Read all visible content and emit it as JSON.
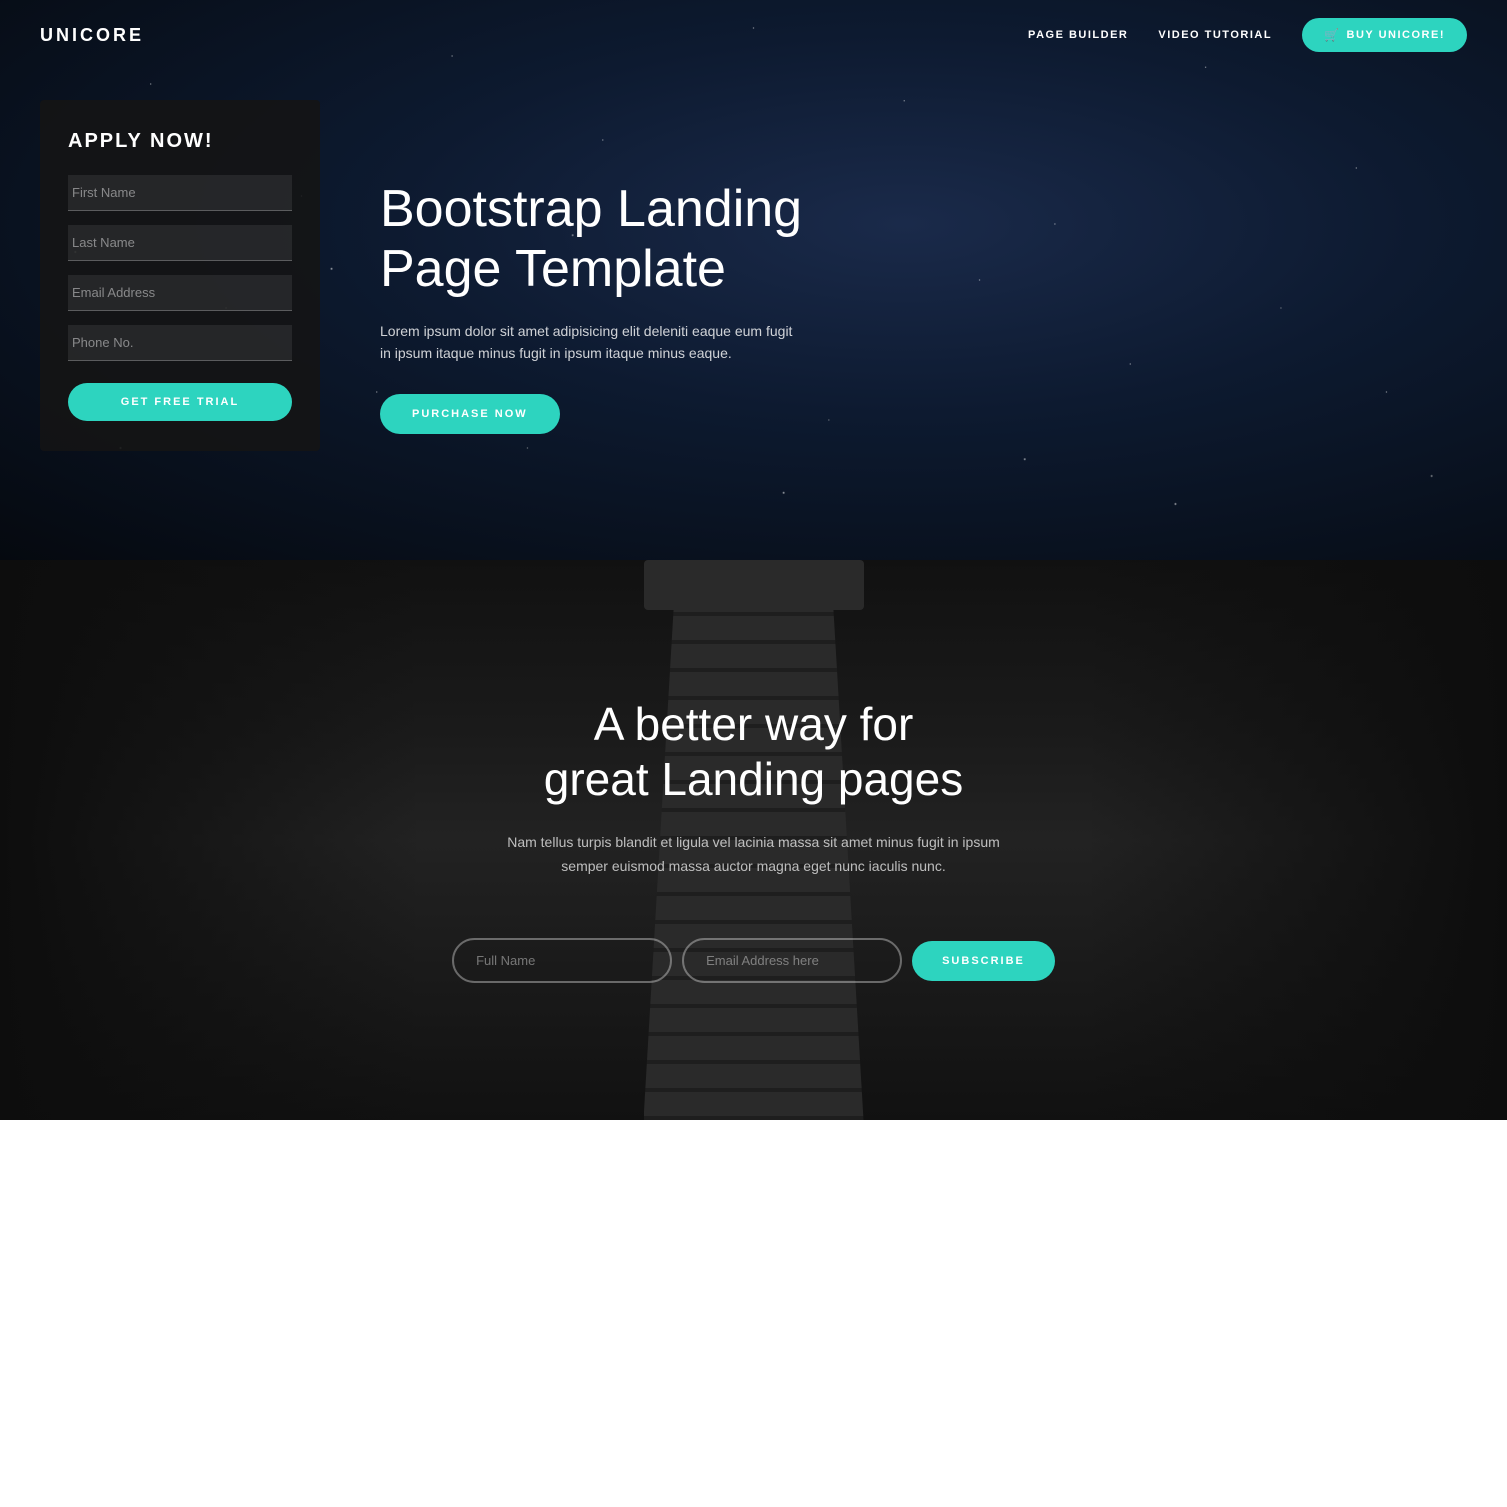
{
  "brand": {
    "name": "UNICORE"
  },
  "navbar": {
    "links": [
      {
        "label": "PAGE BUILDER"
      },
      {
        "label": "VIDEO TUTORIAL"
      }
    ],
    "buy_button": "BUY UNICORE!"
  },
  "hero": {
    "apply_card": {
      "title": "APPLY NOW!",
      "fields": [
        {
          "placeholder": "First Name"
        },
        {
          "placeholder": "Last Name"
        },
        {
          "placeholder": "Email Address"
        },
        {
          "placeholder": "Phone No."
        }
      ],
      "button": "GET FREE TRIAL"
    },
    "heading": "Bootstrap Landing Page Template",
    "description": "Lorem ipsum dolor sit amet adipisicing elit deleniti eaque eum fugit in ipsum itaque minus fugit in ipsum itaque minus eaque.",
    "cta_button": "PURCHASE NOW"
  },
  "section2": {
    "heading_line1": "A better way for",
    "heading_line2": "great Landing pages",
    "description": "Nam tellus turpis blandit et ligula vel lacinia massa sit amet minus fugit in ipsum semper euismod massa auctor magna eget nunc iaculis nunc.",
    "subscribe": {
      "fullname_placeholder": "Full Name",
      "email_placeholder": "Email Address here",
      "button": "SUBSCRIBE"
    }
  },
  "colors": {
    "accent": "#2dd4bf",
    "dark_bg": "#111111",
    "hero_bg": "#0d1a30"
  }
}
